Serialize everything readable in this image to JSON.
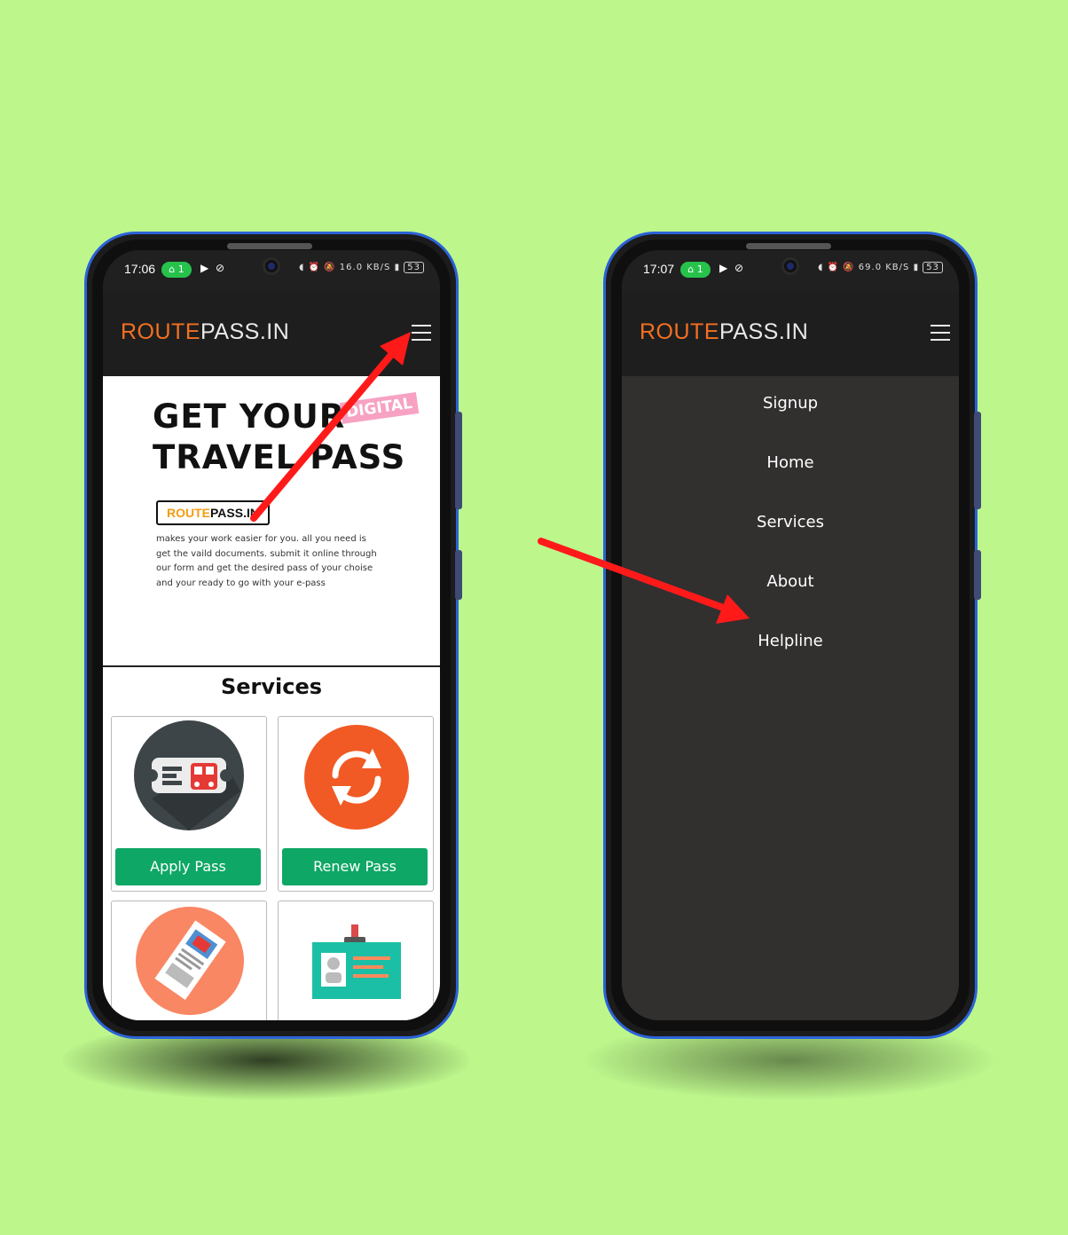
{
  "left_phone": {
    "status": {
      "time": "17:06",
      "hotspot_count": "1",
      "speed": "16.0 KB/S",
      "battery": "53"
    },
    "header": {
      "brand_prefix": "ROUTE",
      "brand_suffix": "PASS.IN"
    },
    "hero": {
      "line1": "GET YOUR",
      "line2": "TRAVEL PASS",
      "badge": "DIGITAL",
      "chip_prefix": "ROUTE",
      "chip_suffix": "PASS.IN",
      "description": "makes your work easier for you. all you need is get the vaild documents. submit it online through our form and get the desired pass of your choise and your ready to go with your e-pass"
    },
    "services": {
      "title": "Services",
      "cards": [
        {
          "label": "Apply Pass",
          "icon": "bus-ticket-icon"
        },
        {
          "label": "Renew Pass",
          "icon": "refresh-icon"
        },
        {
          "icon": "travel-ticket-icon"
        },
        {
          "icon": "id-card-icon"
        }
      ]
    }
  },
  "right_phone": {
    "status": {
      "time": "17:07",
      "hotspot_count": "1",
      "speed": "69.0 KB/S",
      "battery": "53"
    },
    "header": {
      "brand_prefix": "ROUTE",
      "brand_suffix": "PASS.IN"
    },
    "menu": {
      "items": [
        "Signup",
        "Home",
        "Services",
        "About",
        "Helpline"
      ]
    }
  },
  "colors": {
    "background": "#bdf78c",
    "brand_orange": "#f37021",
    "button_green": "#0ea765",
    "arrow_red": "#ff1a1a",
    "menu_bg": "#322f2f"
  }
}
